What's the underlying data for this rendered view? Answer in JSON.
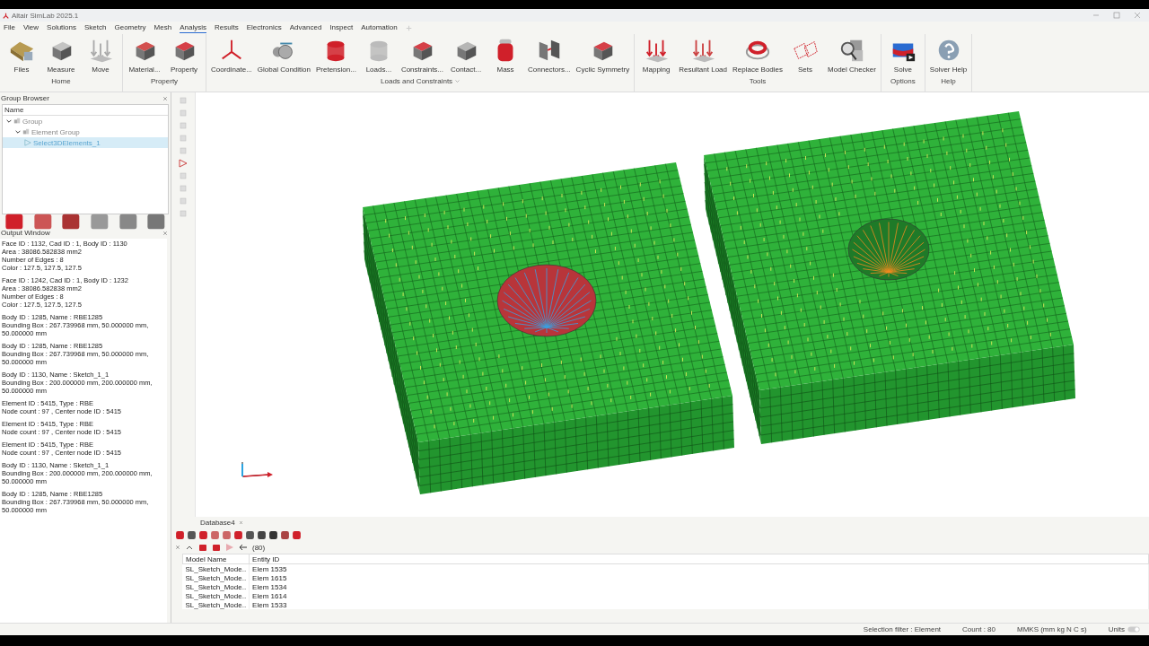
{
  "window": {
    "title": "Altair SimLab 2025.1"
  },
  "menu": [
    {
      "label": "File",
      "selected": false
    },
    {
      "label": "View",
      "selected": false
    },
    {
      "label": "Solutions",
      "selected": false
    },
    {
      "label": "Sketch",
      "selected": false
    },
    {
      "label": "Geometry",
      "selected": false
    },
    {
      "label": "Mesh",
      "selected": false
    },
    {
      "label": "Analysis",
      "selected": true
    },
    {
      "label": "Results",
      "selected": false
    },
    {
      "label": "Electronics",
      "selected": false
    },
    {
      "label": "Advanced",
      "selected": false
    },
    {
      "label": "Inspect",
      "selected": false
    },
    {
      "label": "Automation",
      "selected": false
    }
  ],
  "ribbon": [
    {
      "label": "Home",
      "items": [
        "Files",
        "Measure",
        "Move"
      ]
    },
    {
      "label": "Property",
      "items": [
        "Material...",
        "Property"
      ]
    },
    {
      "label": "Loads and Constraints",
      "items": [
        "Coordinate...",
        "Global Condition",
        "Pretension...",
        "Loads...",
        "Constraints...",
        "Contact...",
        "Mass",
        "Connectors...",
        "Cyclic Symmetry"
      ]
    },
    {
      "label": "Tools",
      "items": [
        "Mapping",
        "Resultant Load",
        "Replace Bodies",
        "Sets",
        "Model Checker"
      ]
    },
    {
      "label": "Options",
      "items": [
        "Solve"
      ]
    },
    {
      "label": "Help",
      "items": [
        "Solver Help"
      ]
    }
  ],
  "group_browser": {
    "title": "Group Browser",
    "column": "Name",
    "tree": [
      {
        "label": "Group",
        "expanded": true,
        "selected": false,
        "children": [
          {
            "label": "Element Group",
            "expanded": true,
            "selected": false,
            "children": [
              {
                "label": "Select3DElements_1",
                "selected": true
              }
            ]
          }
        ]
      }
    ]
  },
  "output_window": {
    "title": "Output Window",
    "blocks": [
      [
        "Face ID : 1132, Cad ID : 1, Body ID : 1130",
        "Area : 38086.582838 mm2",
        "Number of Edges : 8",
        "Color : 127.5, 127.5, 127.5"
      ],
      [
        "Face ID : 1242, Cad ID : 1, Body ID : 1232",
        "Area : 38086.582838 mm2",
        "Number of Edges : 8",
        "Color : 127.5, 127.5, 127.5"
      ],
      [
        "Body ID : 1285, Name : RBE1285",
        "Bounding Box : 267.739968 mm, 50.000000 mm,",
        "50.000000 mm"
      ],
      [
        "Body ID : 1285, Name : RBE1285",
        "Bounding Box : 267.739968 mm, 50.000000 mm,",
        "50.000000 mm"
      ],
      [
        "Body ID : 1130, Name : Sketch_1_1",
        "Bounding Box : 200.000000 mm, 200.000000 mm,",
        "50.000000 mm"
      ],
      [
        "Element ID : 5415, Type : RBE",
        "Node count : 97 , Center node ID : 5415"
      ],
      [
        "Element ID : 5415, Type : RBE",
        "Node count : 97 , Center node ID : 5415"
      ],
      [
        "Element ID : 5415, Type : RBE",
        "Node count : 97 , Center node ID : 5415"
      ],
      [
        "Body ID : 1130, Name : Sketch_1_1",
        "Bounding Box : 200.000000 mm, 200.000000 mm,",
        "50.000000 mm"
      ],
      [
        "Body ID : 1285, Name : RBE1285",
        "Bounding Box : 267.739968 mm, 50.000000 mm,",
        "50.000000 mm"
      ]
    ]
  },
  "document_tab": {
    "label": "Database4"
  },
  "selection": {
    "count": "(80)",
    "columns": [
      "Model Name",
      "Entity ID"
    ],
    "rows": [
      [
        "SL_Sketch_Mode..",
        "Elem 1535"
      ],
      [
        "SL_Sketch_Mode..",
        "Elem 1615"
      ],
      [
        "SL_Sketch_Mode..",
        "Elem 1534"
      ],
      [
        "SL_Sketch_Mode..",
        "Elem 1614"
      ],
      [
        "SL_Sketch_Mode..",
        "Elem 1533"
      ]
    ]
  },
  "status_bar": {
    "selection_filter": "Selection filter : Element",
    "count": "Count : 80",
    "units_system": "MMKS (mm kg N C s)",
    "units_label": "Units"
  }
}
